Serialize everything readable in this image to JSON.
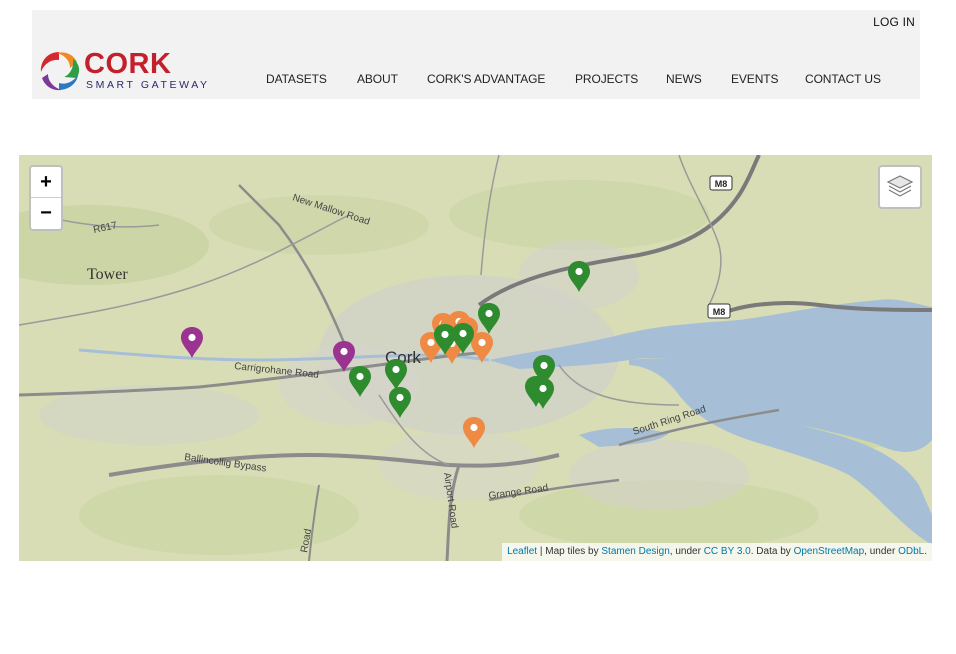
{
  "header": {
    "login": "LOG IN",
    "logo": {
      "name": "CORK",
      "tagline": "SMART GATEWAY"
    },
    "nav": [
      "DATASETS",
      "ABOUT",
      "CORK'S ADVANTAGE",
      "PROJECTS",
      "NEWS",
      "EVENTS",
      "CONTACT US"
    ]
  },
  "map": {
    "zoom_in": "+",
    "zoom_out": "−",
    "labels": {
      "city": "Cork",
      "tower": "Tower",
      "r617": "R617",
      "m8_a": "M8",
      "m8_b": "M8",
      "new_mallow": "New Mallow Road",
      "carrigrohane": "Carrigrohane Road",
      "ballincollig": "Ballincollig Bypass",
      "airport": "Airport Road",
      "grange": "Grange Road",
      "south_ring": "South Ring Road",
      "rossa": "Road"
    },
    "marker_colors": {
      "green": "#2e8b2e",
      "orange": "#ef8a45",
      "purple": "#9b3391"
    },
    "attribution": {
      "leaflet": "Leaflet",
      "sep1": " | Map tiles by ",
      "stamen": "Stamen Design",
      "sep2": ", under ",
      "ccby": "CC BY 3.0",
      "sep3": ". Data by ",
      "osm": "OpenStreetMap",
      "sep4": ", under ",
      "odbl": "ODbL",
      "end": "."
    }
  }
}
